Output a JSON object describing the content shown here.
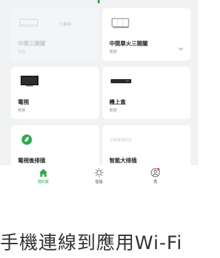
{
  "devices": [
    {
      "name": "中間三開關",
      "room": "餐廳",
      "status": "已離線",
      "icon": "switch-icon"
    },
    {
      "name": "中間單火三開關",
      "room": "餐廳",
      "icon": "single-fire-switch-icon"
    },
    {
      "name": "電視",
      "room": "餐廳",
      "icon": "tv-icon"
    },
    {
      "name": "機上盒",
      "room": "餐廳",
      "icon": "set-top-box-icon"
    },
    {
      "name": "電視後排插",
      "room": "",
      "icon": "power-strip-leaf-icon"
    },
    {
      "name": "智能大排插",
      "room": "",
      "icon": "power-strip-icon"
    }
  ],
  "tabs": [
    {
      "label": "我的家",
      "icon": "home-icon",
      "active": true
    },
    {
      "label": "智能",
      "icon": "smart-icon"
    },
    {
      "label": "我",
      "icon": "profile-icon"
    }
  ],
  "caption": "手機連線到應用Wi-Fi",
  "colors": {
    "accent": "#2fa84f",
    "background": "#f1f2f4",
    "badge": "#e53935"
  }
}
